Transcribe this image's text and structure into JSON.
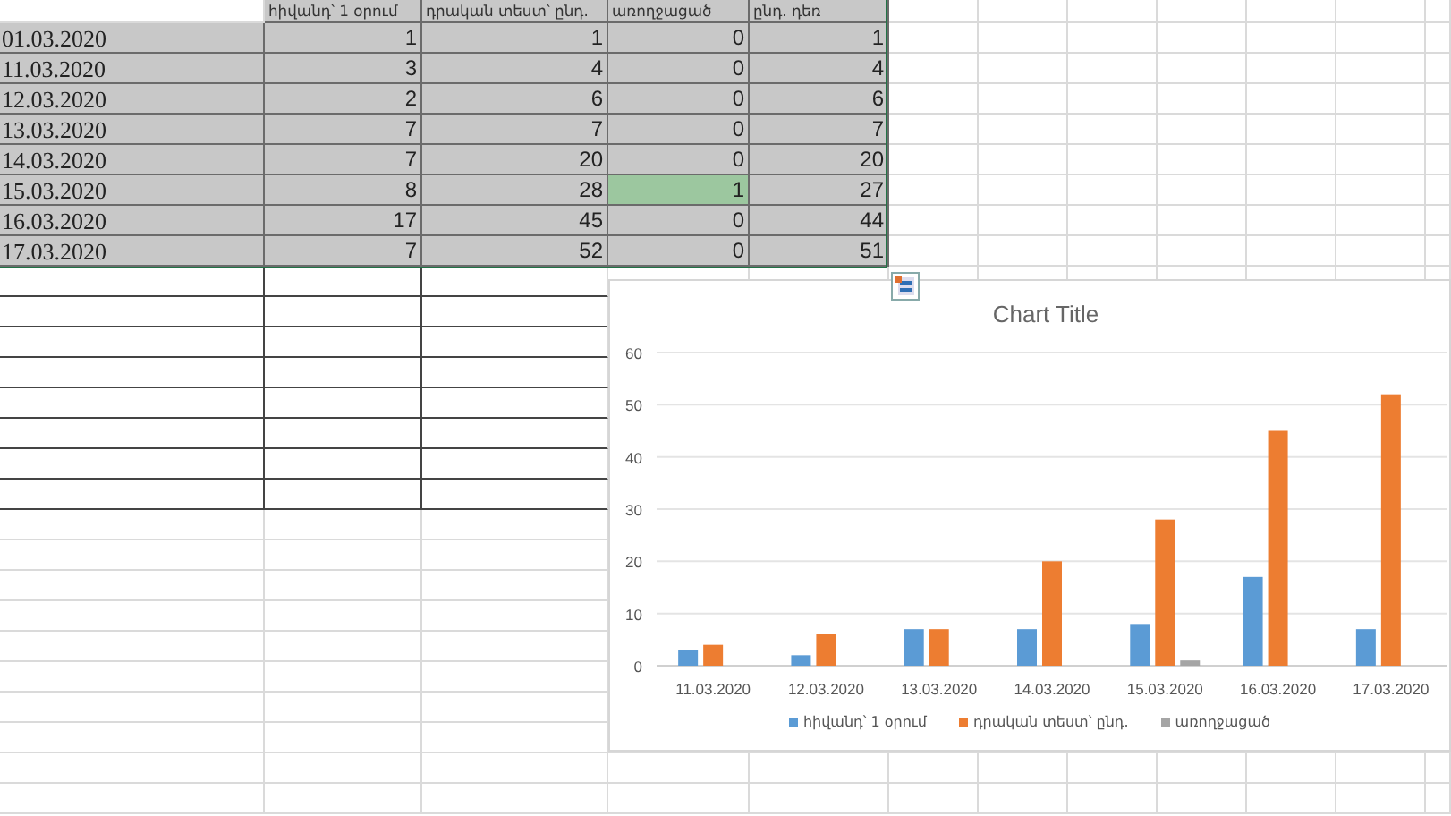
{
  "table": {
    "columns": [
      "հիվանդ՝ 1 օրում",
      "դրական տեստ՝ ընդ.",
      "առողջացած",
      "ընդ. դեռ"
    ],
    "rows": [
      {
        "date": "01.03.2020",
        "cells": [
          {
            "text": "1",
            "selected": false
          },
          {
            "text": "1",
            "selected": false
          },
          {
            "text": "0",
            "selected": false
          },
          {
            "text": "1",
            "selected": false
          }
        ]
      },
      {
        "date": "11.03.2020",
        "cells": [
          {
            "text": "3",
            "selected": false
          },
          {
            "text": "4",
            "selected": false
          },
          {
            "text": "0",
            "selected": false
          },
          {
            "text": "4",
            "selected": false
          }
        ]
      },
      {
        "date": "12.03.2020",
        "cells": [
          {
            "text": "2",
            "selected": false
          },
          {
            "text": "6",
            "selected": false
          },
          {
            "text": "0",
            "selected": false
          },
          {
            "text": "6",
            "selected": false
          }
        ]
      },
      {
        "date": "13.03.2020",
        "cells": [
          {
            "text": "7",
            "selected": false
          },
          {
            "text": "7",
            "selected": false
          },
          {
            "text": "0",
            "selected": false
          },
          {
            "text": "7",
            "selected": false
          }
        ]
      },
      {
        "date": "14.03.2020",
        "cells": [
          {
            "text": "7",
            "selected": false
          },
          {
            "text": "20",
            "selected": false
          },
          {
            "text": "0",
            "selected": false
          },
          {
            "text": "20",
            "selected": false
          }
        ]
      },
      {
        "date": "15.03.2020",
        "cells": [
          {
            "text": "8",
            "selected": false
          },
          {
            "text": "28",
            "selected": false
          },
          {
            "text": "1",
            "selected": true
          },
          {
            "text": "27",
            "selected": false
          }
        ]
      },
      {
        "date": "16.03.2020",
        "cells": [
          {
            "text": "17",
            "selected": false
          },
          {
            "text": "45",
            "selected": false
          },
          {
            "text": "0",
            "selected": false
          },
          {
            "text": "44",
            "selected": false
          }
        ]
      },
      {
        "date": "17.03.2020",
        "cells": [
          {
            "text": "7",
            "selected": false
          },
          {
            "text": "52",
            "selected": false
          },
          {
            "text": "0",
            "selected": false
          },
          {
            "text": "51",
            "selected": false
          }
        ]
      }
    ]
  },
  "chart": {
    "chart_data": {
      "type": "bar",
      "title": "Chart Title",
      "categories": [
        "11.03.2020",
        "12.03.2020",
        "13.03.2020",
        "14.03.2020",
        "15.03.2020",
        "16.03.2020",
        "17.03.2020"
      ],
      "series": [
        {
          "name": "հիվանդ՝ 1 օրում",
          "color": "#5b9bd5",
          "values": [
            3,
            2,
            7,
            7,
            8,
            17,
            7
          ]
        },
        {
          "name": "դրական տեստ՝ ընդ.",
          "color": "#ed7d31",
          "values": [
            4,
            6,
            7,
            20,
            28,
            45,
            52
          ]
        },
        {
          "name": "առողջացած",
          "color": "#a5a5a5",
          "values": [
            0,
            0,
            0,
            0,
            1,
            0,
            0
          ]
        }
      ],
      "grid": true,
      "legend": "bottom",
      "ylim": [
        0,
        60
      ],
      "yticks": [
        0,
        10,
        20,
        30,
        40,
        50,
        60
      ]
    }
  }
}
